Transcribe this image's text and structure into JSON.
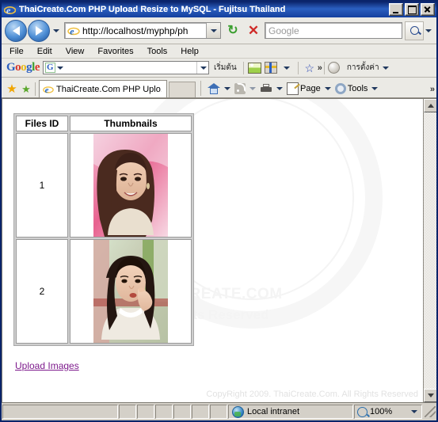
{
  "window": {
    "title": "ThaiCreate.Com PHP Upload Resize to MySQL - Fujitsu Thailand",
    "minimize_label": "Minimize",
    "maximize_label": "Maximize",
    "close_label": "Close"
  },
  "nav": {
    "back_label": "Back",
    "forward_label": "Forward",
    "history_label": "Recent Pages",
    "address_value": "http://localhost/myphp/ph",
    "address_dropdown_label": "Address history",
    "refresh_label": "Refresh",
    "refresh_glyph": "↻",
    "stop_label": "Stop",
    "stop_glyph": "✕",
    "search_placeholder": "Google",
    "search_value": "",
    "search_go_label": "Search",
    "search_dropdown_label": "Change search provider"
  },
  "menu": {
    "items": [
      {
        "label": "File"
      },
      {
        "label": "Edit"
      },
      {
        "label": "View"
      },
      {
        "label": "Favorites"
      },
      {
        "label": "Tools"
      },
      {
        "label": "Help"
      }
    ]
  },
  "google_toolbar": {
    "logo": "Google",
    "logo_letters": [
      "G",
      "o",
      "o",
      "g",
      "l",
      "e"
    ],
    "search_placeholder": "",
    "search_value": "",
    "g_badge": "G",
    "start_label": "เริ่มต้น",
    "photos_label": "Photos",
    "gadgets_label": "Gadgets",
    "bookmarks_label": "Bookmarks",
    "more_label": "»",
    "settings_label": "การตั้งค่า"
  },
  "tabbar": {
    "favorites_label": "Favorites Center",
    "add_favorite_label": "Add to Favorites",
    "tab_title": "ThaiCreate.Com PHP Uplo...",
    "new_tab_label": "New Tab",
    "home_label": "Home",
    "feeds_label": "Feeds",
    "print_label": "Print",
    "page_label": "Page",
    "tools_label": "Tools",
    "more_label": "»"
  },
  "page": {
    "table": {
      "headers": [
        "Files ID",
        "Thumbnails"
      ],
      "rows": [
        {
          "id": "1",
          "thumbnail_alt": "Thumbnail 1 - portrait of woman with long dark hair, pink background"
        },
        {
          "id": "2",
          "thumbnail_alt": "Thumbnail 2 - portrait of woman in white shirt, outdoor background"
        }
      ]
    },
    "upload_link": "Upload Images",
    "watermark_line1": "THAICREATE.COM",
    "watermark_line2": "All Rights Reserved",
    "copyright": "CopyRight 2009. ThaiCreate.Com. All Rights Reserved",
    "scroll_up_label": "Scroll up",
    "scroll_down_label": "Scroll down"
  },
  "statusbar": {
    "message": "",
    "zone": "Local intranet",
    "zoom": "100%",
    "zoom_dropdown_label": "Change zoom level",
    "resize_grip_label": "Resize"
  },
  "colors": {
    "title_bar": "#0a246a",
    "chrome": "#ebeae5",
    "status_bg": "#d4d0c8",
    "link_visited": "#7d1a8c",
    "page_bg": "#ffffff"
  }
}
